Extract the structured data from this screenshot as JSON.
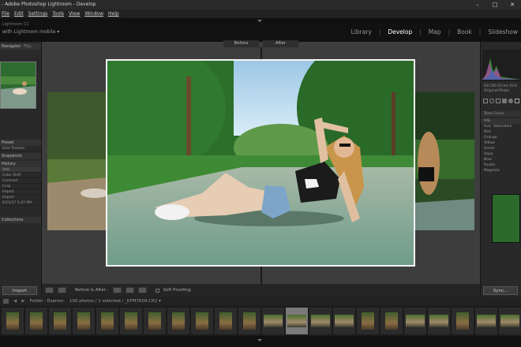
{
  "titlebar": {
    "title": "- Adobe Photoshop Lightroom - Develop"
  },
  "menu": {
    "items": [
      "File",
      "Edit",
      "Settings",
      "Tools",
      "View",
      "Window",
      "Help"
    ]
  },
  "identity": {
    "line1": "Lightroom CC",
    "line2": "with Lightroom mobile ▾"
  },
  "modules": {
    "items": [
      "Library",
      "Develop",
      "Map",
      "Book",
      "Slideshow"
    ],
    "active": "Develop",
    "separator": "|"
  },
  "left_panel": {
    "navigator_label": "Navigator",
    "navigator_fit": "FILL",
    "rows": [
      "Preset",
      "User Presets",
      "Snapshots",
      "History",
      "Add",
      "Color Shift",
      "Contrast",
      "Crop",
      "Import",
      "Export",
      "Collections"
    ],
    "history_time": "6/15/17 5:47 PM",
    "collections_label": "Collections"
  },
  "center": {
    "before_label": "Before",
    "after_label": "After"
  },
  "toolbar": {
    "before_after_label": "Before & After :",
    "soft_proofing_label": "Soft Proofing"
  },
  "buttons": {
    "import_label": "Import",
    "sync_label": "Sync..."
  },
  "right_panel": {
    "histogram_values": "ISO 200  50 mm  f/2.8",
    "original_photo_label": "Original Photo",
    "tone_curve_label": "Tone Curve",
    "hsl_label": "HSL",
    "hsl_tabs": [
      "Hue",
      "Saturation",
      "Luminance"
    ],
    "hsl_rows": [
      "Red",
      "Orange",
      "Yellow",
      "Green",
      "Aqua",
      "Blue",
      "Purple",
      "Magenta"
    ]
  },
  "filmstrip": {
    "source_label": "Folder : Expresi-",
    "count_label": "100 photos / 1 selected / _KFM7609.CR2 ▾",
    "thumbs": [
      "p",
      "p",
      "p",
      "p",
      "p",
      "p",
      "p",
      "p",
      "p",
      "p",
      "p",
      "w",
      "w",
      "w",
      "w",
      "p",
      "p",
      "w",
      "w",
      "p",
      "w",
      "w",
      "p"
    ],
    "selected_index": 12
  },
  "colors": {
    "accent": "#ffffff",
    "panel": "#292929",
    "background": "#3d3d3d"
  }
}
